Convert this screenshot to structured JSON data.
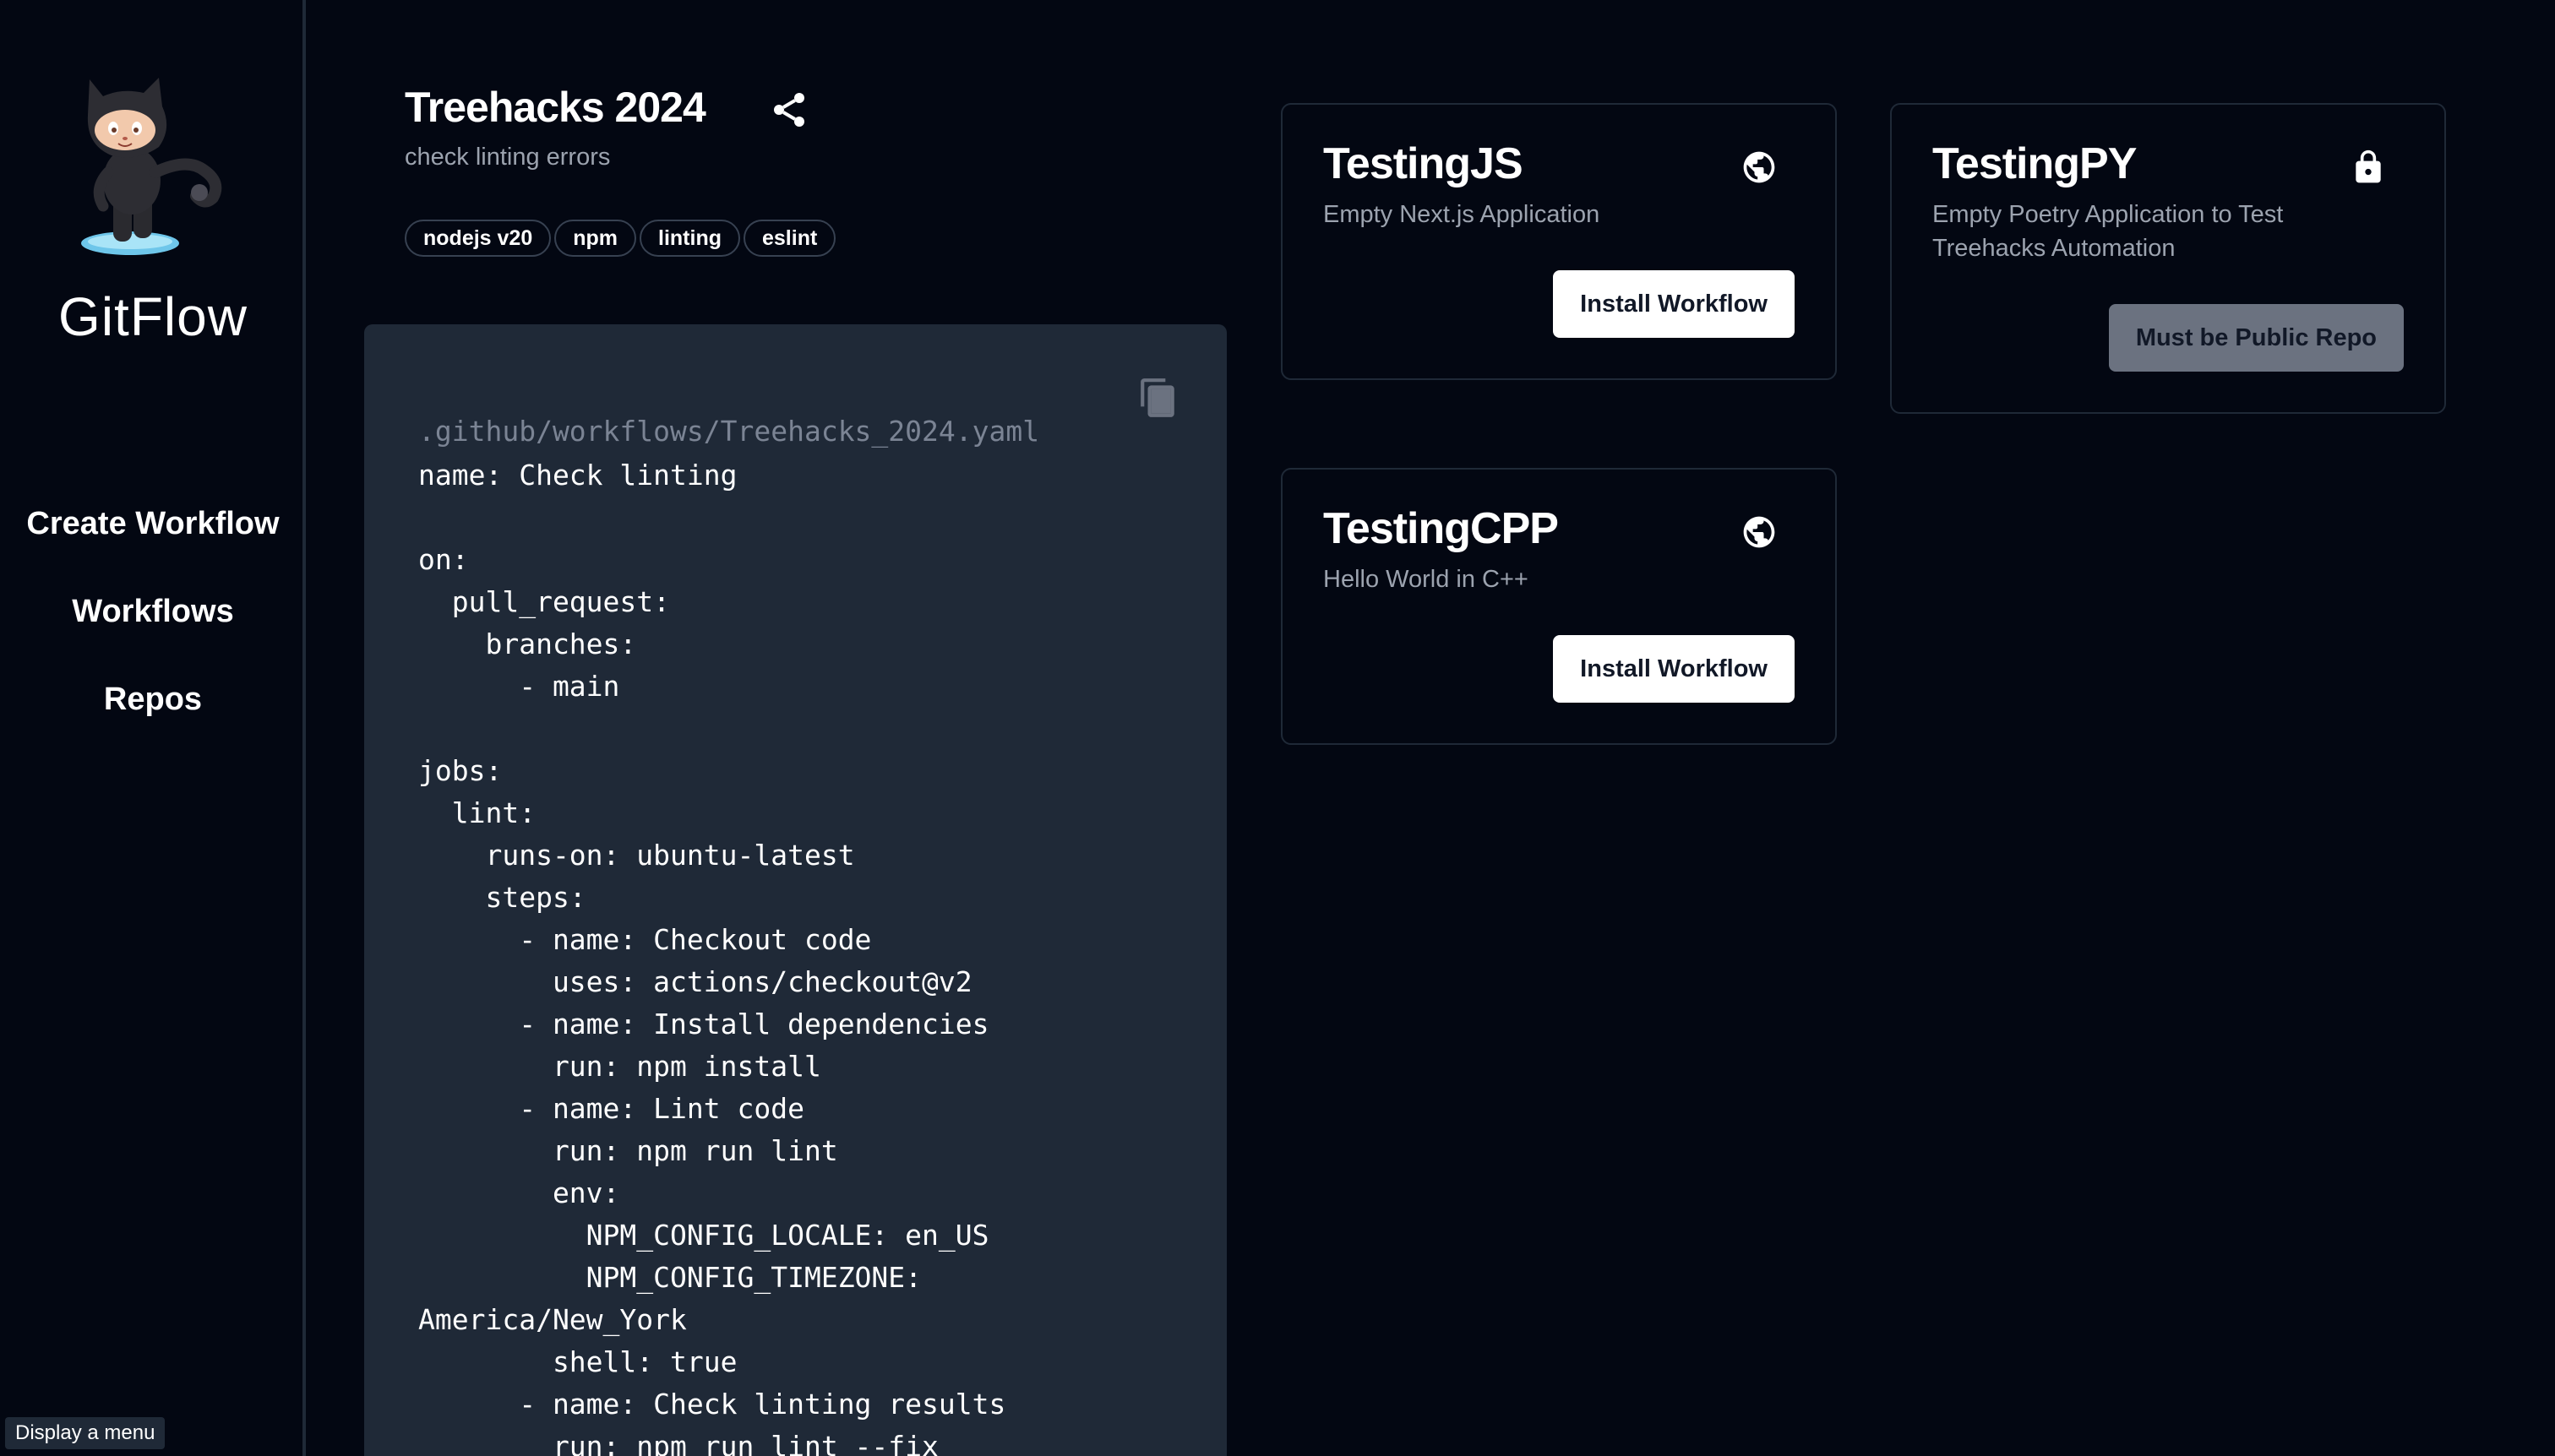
{
  "sidebar": {
    "brand": "GitFlow",
    "nav": [
      {
        "label": "Create Workflow"
      },
      {
        "label": "Workflows"
      },
      {
        "label": "Repos"
      }
    ]
  },
  "tooltip": "Display a menu",
  "workflow": {
    "title": "Treehacks 2024",
    "description": "check linting errors",
    "tags": [
      "nodejs v20",
      "npm",
      "linting",
      "eslint"
    ],
    "file_path": ".github/workflows/Treehacks_2024.yaml",
    "code": "name: Check linting\n\non:\n  pull_request:\n    branches:\n      - main\n\njobs:\n  lint:\n    runs-on: ubuntu-latest\n    steps:\n      - name: Checkout code\n        uses: actions/checkout@v2\n      - name: Install dependencies\n        run: npm install\n      - name: Lint code\n        run: npm run lint\n        env:\n          NPM_CONFIG_LOCALE: en_US\n          NPM_CONFIG_TIMEZONE:\nAmerica/New_York\n        shell: true\n      - name: Check linting results\n        run: npm run lint --fix"
  },
  "repos": [
    {
      "name": "TestingJS",
      "description": "Empty Next.js Application",
      "visibility_icon": "globe-icon",
      "button_label": "Install Workflow",
      "button_disabled": false
    },
    {
      "name": "TestingPY",
      "description": "Empty Poetry Application to Test Treehacks Automation",
      "visibility_icon": "lock-icon",
      "button_label": "Must be Public Repo",
      "button_disabled": true
    },
    {
      "name": "TestingCPP",
      "description": "Hello World in C++",
      "visibility_icon": "globe-icon",
      "button_label": "Install Workflow",
      "button_disabled": false
    }
  ],
  "colors": {
    "background": "#030712",
    "sidebar_border": "#1f2937",
    "code_panel": "#1f2937",
    "muted_text": "#9ca3af",
    "button_bg": "#ffffff",
    "button_disabled_bg": "#6b7280"
  }
}
